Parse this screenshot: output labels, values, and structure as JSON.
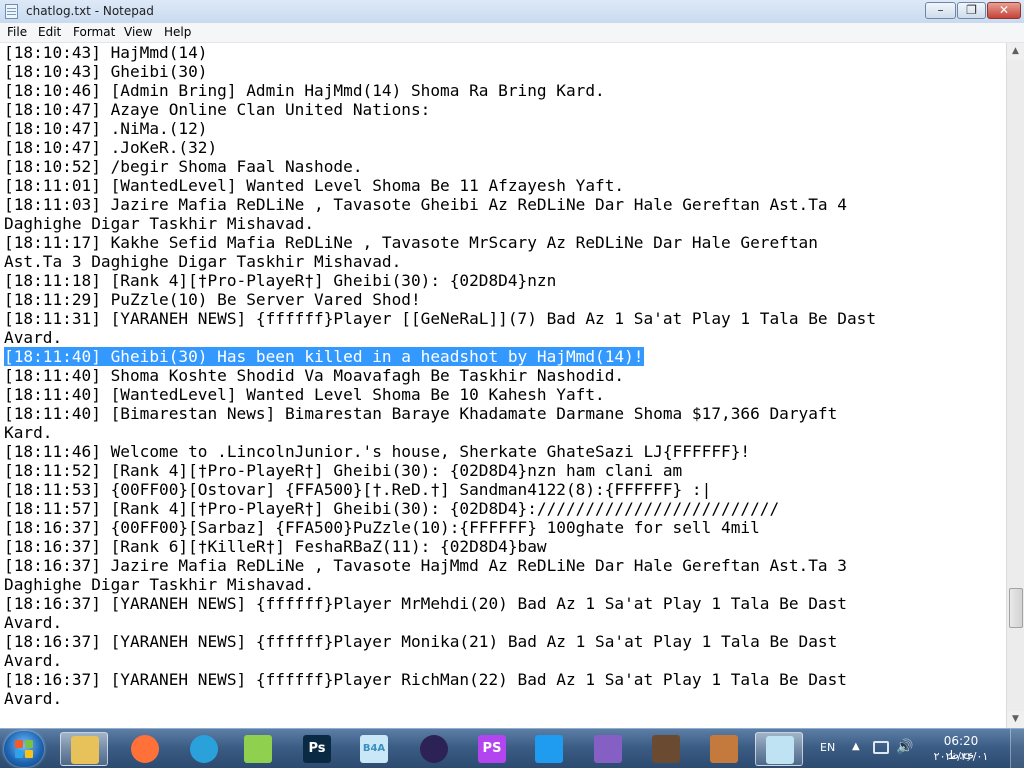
{
  "window": {
    "title": "chatlog.txt - Notepad",
    "controls": {
      "minimize": "–",
      "maximize": "❐",
      "close": "✕"
    }
  },
  "menu": [
    "File",
    "Edit",
    "Format",
    "View",
    "Help"
  ],
  "editor": {
    "lines": [
      "[18:10:43] HajMmd(14)",
      "[18:10:43] Gheibi(30)",
      "[18:10:46] [Admin Bring] Admin HajMmd(14) Shoma Ra Bring Kard.",
      "[18:10:47] Azaye Online Clan United Nations:",
      "[18:10:47] .NiMa.(12)",
      "[18:10:47] .JoKeR.(32)",
      "[18:10:52] /begir Shoma Faal Nashode.",
      "[18:11:01] [WantedLevel] Wanted Level Shoma Be 11 Afzayesh Yaft.",
      "[18:11:03] Jazire Mafia ReDLiNe , Tavasote Gheibi Az ReDLiNe Dar Hale Gereftan Ast.Ta 4",
      "Daghighe Digar Taskhir Mishavad.",
      "[18:11:17] Kakhe Sefid Mafia ReDLiNe , Tavasote MrScary Az ReDLiNe Dar Hale Gereftan",
      "Ast.Ta 3 Daghighe Digar Taskhir Mishavad.",
      "[18:11:18] [Rank 4][†Pro-PlayeR†] Gheibi(30): {02D8D4}nzn",
      "[18:11:29] PuZzle(10) Be Server Vared Shod!",
      "[18:11:31] [YARANEH NEWS] {ffffff}Player [[GeNeRaL]](7) Bad Az 1 Sa'at Play 1 Tala Be Dast",
      "Avard.",
      "[18:11:40] Gheibi(30) Has been killed in a headshot by HajMmd(14)!",
      "[18:11:40] Shoma Koshte Shodid Va Moavafagh Be Taskhir Nashodid.",
      "[18:11:40] [WantedLevel] Wanted Level Shoma Be 10 Kahesh Yaft.",
      "[18:11:40] [Bimarestan News] Bimarestan Baraye Khadamate Darmane Shoma $17,366 Daryaft",
      "Kard.",
      "[18:11:46] Welcome to .LincolnJunior.'s house, Sherkate GhateSazi LJ{FFFFFF}!",
      "[18:11:52] [Rank 4][†Pro-PlayeR†] Gheibi(30): {02D8D4}nzn ham clani am",
      "[18:11:53] {00FF00}[Ostovar] {FFA500}[†.ReD.†] Sandman4122(8):{FFFFFF} :|",
      "[18:11:57] [Rank 4][†Pro-PlayeR†] Gheibi(30): {02D8D4}://///////////////////////",
      "[18:16:37] {00FF00}[Sarbaz] {FFA500}PuZzle(10):{FFFFFF} 100ghate for sell 4mil",
      "[18:16:37] [Rank 6][†KilleR†] FeshaRBaZ(11): {02D8D4}baw",
      "[18:16:37] Jazire Mafia ReDLiNe , Tavasote HajMmd Az ReDLiNe Dar Hale Gereftan Ast.Ta 3",
      "Daghighe Digar Taskhir Mishavad.",
      "[18:16:37] [YARANEH NEWS] {ffffff}Player MrMehdi(20) Bad Az 1 Sa'at Play 1 Tala Be Dast",
      "Avard.",
      "[18:16:37] [YARANEH NEWS] {ffffff}Player Monika(21) Bad Az 1 Sa'at Play 1 Tala Be Dast",
      "Avard.",
      "[18:16:37] [YARANEH NEWS] {ffffff}Player RichMan(22) Bad Az 1 Sa'at Play 1 Tala Be Dast",
      "Avard."
    ],
    "selected_line": 16,
    "selection_color": "#3399ff"
  },
  "taskbar": {
    "apps": [
      {
        "name": "file-explorer",
        "label": "",
        "color": "#e7c15a",
        "active": true
      },
      {
        "name": "firefox",
        "label": "",
        "color": "#ff7139",
        "active": false
      },
      {
        "name": "telegram",
        "label": "",
        "color": "#2aa1da",
        "active": false
      },
      {
        "name": "notepad-plus-plus",
        "label": "",
        "color": "#8fd14f",
        "active": false
      },
      {
        "name": "photoshop",
        "label": "Ps",
        "color": "#0a2a44",
        "active": false
      },
      {
        "name": "b4a",
        "label": "B4A",
        "color": "#c9e7f7",
        "active": false
      },
      {
        "name": "eclipse",
        "label": "",
        "color": "#2c2255",
        "active": false
      },
      {
        "name": "phpstorm",
        "label": "PS",
        "color": "#b345f1",
        "active": false
      },
      {
        "name": "vscode",
        "label": "",
        "color": "#1f9cf0",
        "active": false
      },
      {
        "name": "visual-studio",
        "label": "",
        "color": "#865fc5",
        "active": false
      },
      {
        "name": "gta-sa-mp",
        "label": "",
        "color": "#6b4a32",
        "active": false
      },
      {
        "name": "gta-sa-mp-2",
        "label": "",
        "color": "#c47a3c",
        "active": false
      },
      {
        "name": "notepad",
        "label": "",
        "color": "#bfe3f2",
        "active": true
      }
    ]
  },
  "tray": {
    "language": "EN",
    "show_hidden": "▲",
    "volume": "🔊",
    "time": "06:20 ب.ظ",
    "date": "۲۰۲۰/۳۴/۰۱"
  }
}
